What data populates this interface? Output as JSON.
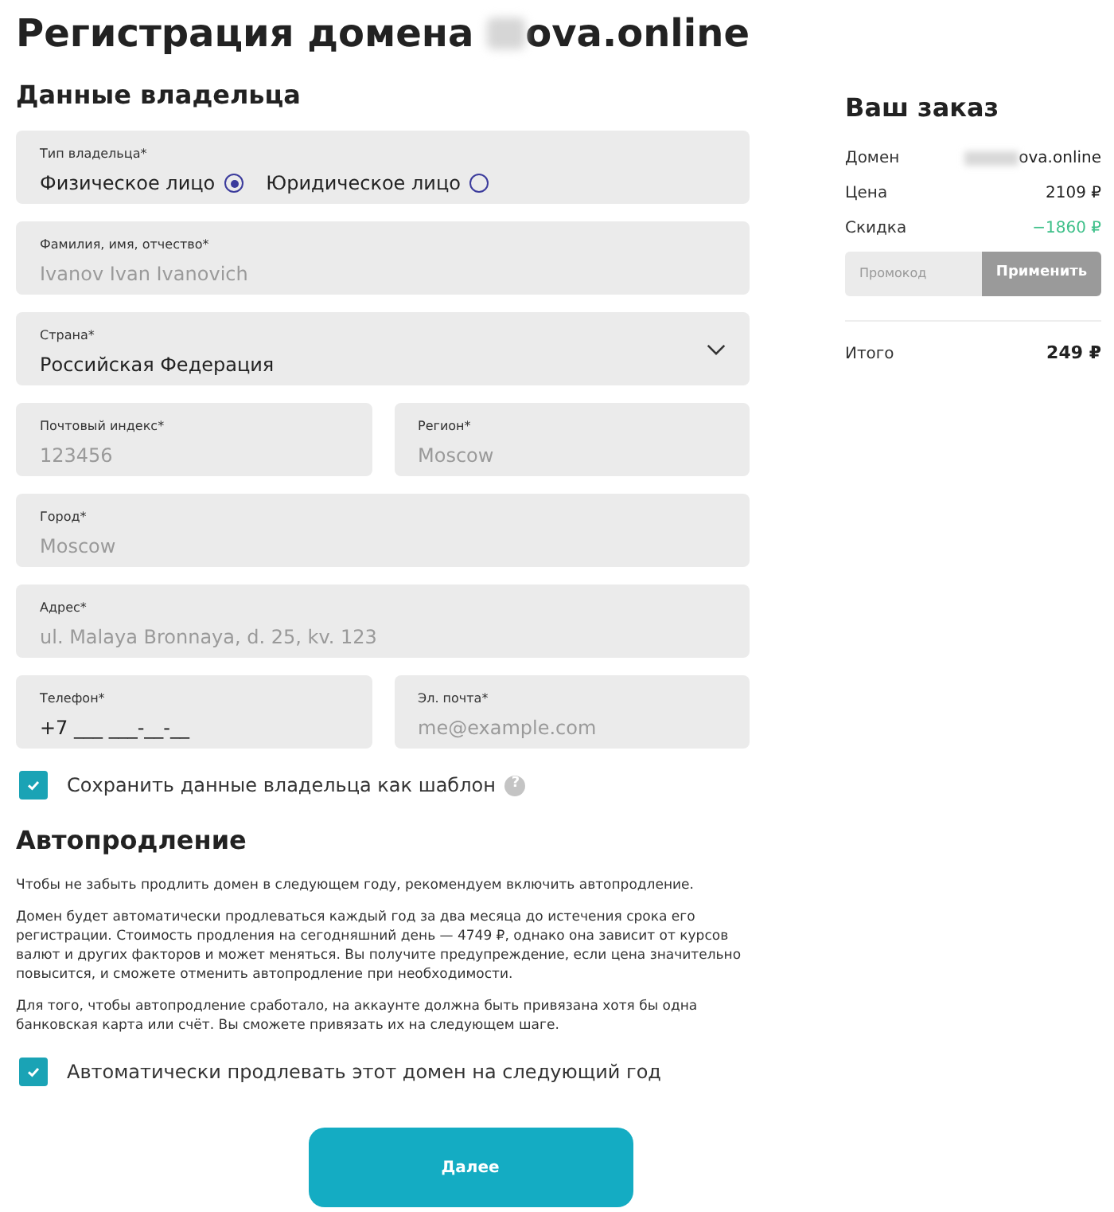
{
  "title": "Регистрация домена",
  "title_domain_visible": "ova.online",
  "owner_section": {
    "heading": "Данные владельца",
    "rows": [
      [
        {
          "kind": "radio",
          "label": "Тип владельца*",
          "options": [
            {
              "label": "Физическое лицо",
              "selected": true
            },
            {
              "label": "Юридическое лицо",
              "selected": false
            }
          ]
        }
      ],
      [
        {
          "kind": "text",
          "label": "Фамилия, имя, отчество*",
          "placeholder": "Ivanov Ivan Ivanovich"
        }
      ],
      [
        {
          "kind": "select",
          "label": "Страна*",
          "value": "Российская Федерация"
        }
      ],
      [
        {
          "kind": "text",
          "label": "Почтовый индекс*",
          "placeholder": "123456"
        },
        {
          "kind": "text",
          "label": "Регион*",
          "placeholder": "Moscow"
        }
      ],
      [
        {
          "kind": "text",
          "label": "Город*",
          "placeholder": "Moscow"
        }
      ],
      [
        {
          "kind": "text",
          "label": "Адрес*",
          "placeholder": "ul. Malaya Bronnaya, d. 25, kv. 123"
        }
      ],
      [
        {
          "kind": "text",
          "label": "Телефон*",
          "value": "+7 ___ ___-__-__"
        },
        {
          "kind": "text",
          "label": "Эл. почта*",
          "placeholder": "me@example.com"
        }
      ]
    ],
    "save_template": {
      "label": "Сохранить данные владельца как шаблон",
      "checked": true,
      "help": "?"
    }
  },
  "autorenew": {
    "heading": "Автопродление",
    "paragraphs": [
      "Чтобы не забыть продлить домен в следующем году, рекомендуем включить автопродление.",
      "Домен будет автоматически продлеваться каждый год за два месяца до истечения срока его регистрации. Стоимость продления на сегодняшний день — 4749 ₽, однако она зависит от курсов валют и других факторов и может меняться. Вы получите предупреждение, если цена значительно повысится, и сможете отменить автопродление при необходимости.",
      "Для того, чтобы автопродление сработало, на аккаунте должна быть привязана хотя бы одна банковская карта или счёт. Вы сможете привязать их на следующем шаге."
    ],
    "checkbox": {
      "label": "Автоматически продлевать этот домен на следующий год",
      "checked": true
    }
  },
  "next_button": "Далее",
  "order": {
    "heading": "Ваш заказ",
    "lines": [
      {
        "label": "Домен",
        "value": "ova.online",
        "kind": "domain"
      },
      {
        "label": "Цена",
        "value": "2109 ₽",
        "kind": "price"
      },
      {
        "label": "Скидка",
        "value": "−1860 ₽",
        "kind": "discount"
      }
    ],
    "promo": {
      "placeholder": "Промокод",
      "button": "Применить"
    },
    "total": {
      "label": "Итого",
      "value": "249 ₽"
    }
  }
}
